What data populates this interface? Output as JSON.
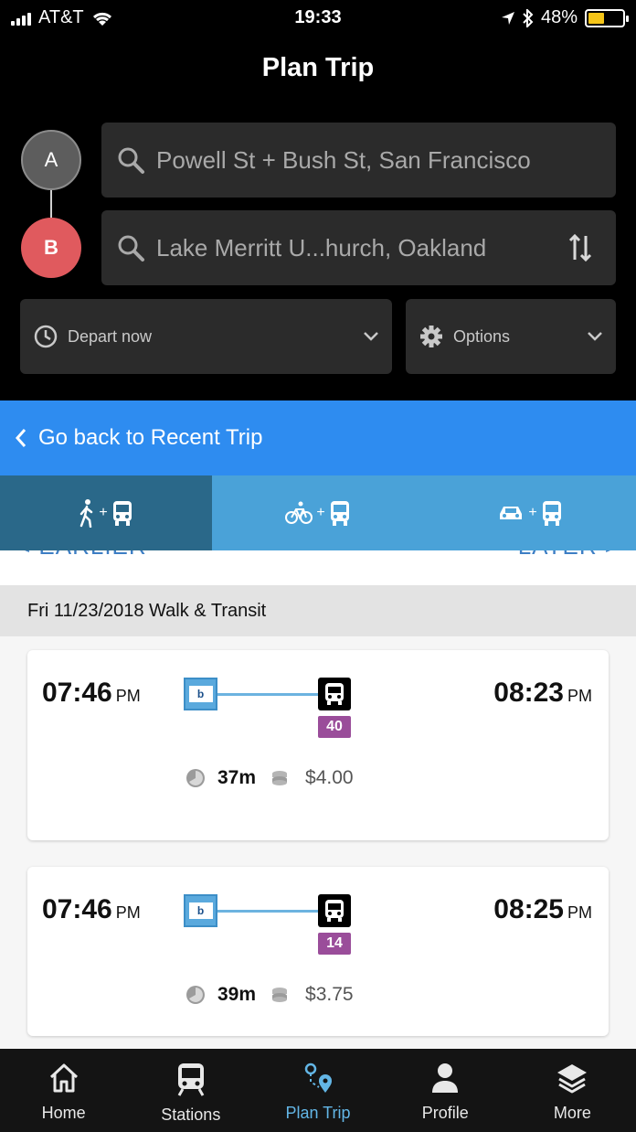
{
  "status": {
    "carrier": "AT&T",
    "time": "19:33",
    "battery": "48%",
    "battery_level": 0.48
  },
  "header": {
    "title": "Plan Trip"
  },
  "trip": {
    "origin_marker": "A",
    "destination_marker": "B",
    "origin": "Powell St + Bush St, San Francisco",
    "destination": "Lake Merritt U...hurch, Oakland",
    "depart_label": "Depart now",
    "options_label": "Options"
  },
  "banner": {
    "go_back_label": "Go back to Recent Trip"
  },
  "pager": {
    "earlier": "< EARLIER",
    "later": "LATER >"
  },
  "results": {
    "date_header": "Fri 11/23/2018 Walk & Transit",
    "itineraries": [
      {
        "depart_time": "07:46",
        "depart_ampm": "PM",
        "arrive_time": "08:23",
        "arrive_ampm": "PM",
        "route": "40",
        "duration": "37m",
        "fare": "$4.00"
      },
      {
        "depart_time": "07:46",
        "depart_ampm": "PM",
        "arrive_time": "08:25",
        "arrive_ampm": "PM",
        "route": "14",
        "duration": "39m",
        "fare": "$3.75"
      }
    ]
  },
  "tabbar": {
    "items": [
      {
        "label": "Home"
      },
      {
        "label": "Stations"
      },
      {
        "label": "Plan Trip"
      },
      {
        "label": "Profile"
      },
      {
        "label": "More"
      }
    ]
  },
  "colors": {
    "accent": "#2e8cf0",
    "tab_active": "#63b6e6",
    "route_badge": "#9a4d9a",
    "destination_marker": "#e05a5e"
  }
}
